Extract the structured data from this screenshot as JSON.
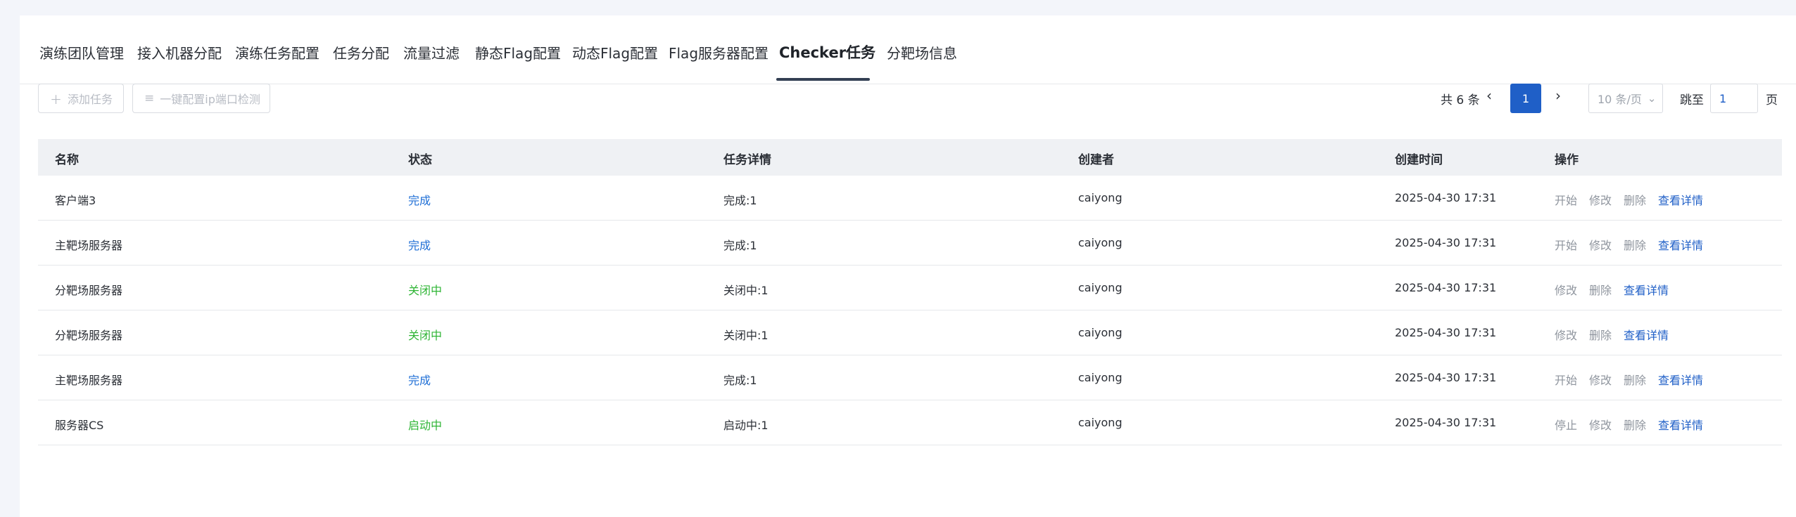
{
  "tabs": [
    {
      "label": "演练团队管理",
      "active": false
    },
    {
      "label": "接入机器分配",
      "active": false
    },
    {
      "label": "演练任务配置",
      "active": false
    },
    {
      "label": "任务分配",
      "active": false
    },
    {
      "label": "流量过滤",
      "active": false
    },
    {
      "label": "静态Flag配置",
      "active": false
    },
    {
      "label": "动态Flag配置",
      "active": false
    },
    {
      "label": "Flag服务器配置",
      "active": false
    },
    {
      "label": "Checker任务",
      "active": true
    },
    {
      "label": "分靶场信息",
      "active": false
    }
  ],
  "toolbar": {
    "add_task_label": "添加任务",
    "add_task_icon": "plus-icon",
    "config_label": "一键配置ip端口检测",
    "config_icon": "list-icon"
  },
  "pagination": {
    "total_text": "共 6 条",
    "current_page": "1",
    "page_size": "10 条/页",
    "jump_label": "跳至",
    "jump_value": "1",
    "page_suffix": "页"
  },
  "table": {
    "headers": [
      "名称",
      "状态",
      "任务详情",
      "创建者",
      "创建时间",
      "操作"
    ],
    "rows": [
      {
        "name": "客户端3",
        "status": "完成",
        "status_color": "#1f6fd6",
        "detail": "完成:1",
        "creator": "caiyong",
        "created": "2025-04-30 17:31",
        "actions": [
          "开始",
          "修改",
          "删除"
        ],
        "detail_action": "查看详情"
      },
      {
        "name": "主靶场服务器",
        "status": "完成",
        "status_color": "#1f6fd6",
        "detail": "完成:1",
        "creator": "caiyong",
        "created": "2025-04-30 17:31",
        "actions": [
          "开始",
          "修改",
          "删除"
        ],
        "detail_action": "查看详情"
      },
      {
        "name": "分靶场服务器",
        "status": "关闭中",
        "status_color": "#2fb535",
        "detail": "关闭中:1",
        "creator": "caiyong",
        "created": "2025-04-30 17:31",
        "actions": [
          "修改",
          "删除"
        ],
        "detail_action": "查看详情"
      },
      {
        "name": "分靶场服务器",
        "status": "关闭中",
        "status_color": "#2fb535",
        "detail": "关闭中:1",
        "creator": "caiyong",
        "created": "2025-04-30 17:31",
        "actions": [
          "修改",
          "删除"
        ],
        "detail_action": "查看详情"
      },
      {
        "name": "主靶场服务器",
        "status": "完成",
        "status_color": "#1f6fd6",
        "detail": "完成:1",
        "creator": "caiyong",
        "created": "2025-04-30 17:31",
        "actions": [
          "开始",
          "修改",
          "删除"
        ],
        "detail_action": "查看详情"
      },
      {
        "name": "服务器CS",
        "status": "启动中",
        "status_color": "#2fb535",
        "detail": "启动中:1",
        "creator": "caiyong",
        "created": "2025-04-30 17:31",
        "actions": [
          "停止",
          "修改",
          "删除"
        ],
        "detail_action": "查看详情"
      }
    ]
  }
}
